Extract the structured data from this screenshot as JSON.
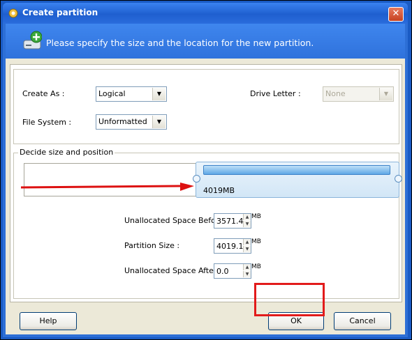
{
  "window": {
    "title": "Create partition",
    "close_label": "✕"
  },
  "banner": {
    "text": "Please specify the size and the location for the new partition."
  },
  "form": {
    "create_as_label": "Create As :",
    "create_as_value": "Logical",
    "file_system_label": "File System :",
    "file_system_value": "Unformatted",
    "drive_letter_label": "Drive Letter :",
    "drive_letter_value": "None"
  },
  "decide": {
    "group_title": "Decide size and position",
    "partition_size_text": "4019MB",
    "before_label": "Unallocated Space Before:",
    "before_value": "3571.4",
    "size_label": "Partition Size :",
    "size_value": "4019.1",
    "after_label": "Unallocated Space After:",
    "after_value": "0.0",
    "unit": "MB"
  },
  "buttons": {
    "help": "Help",
    "ok": "OK",
    "cancel": "Cancel"
  },
  "colors": {
    "title_blue": "#1f5fcf",
    "banner_blue": "#3577e4",
    "highlight_red": "#e21b1b",
    "arrow_red": "#dd1111"
  },
  "icons": [
    "app-icon",
    "disk-add-icon",
    "close-icon",
    "dropdown-arrow-icon",
    "spin-up-icon",
    "spin-down-icon"
  ]
}
